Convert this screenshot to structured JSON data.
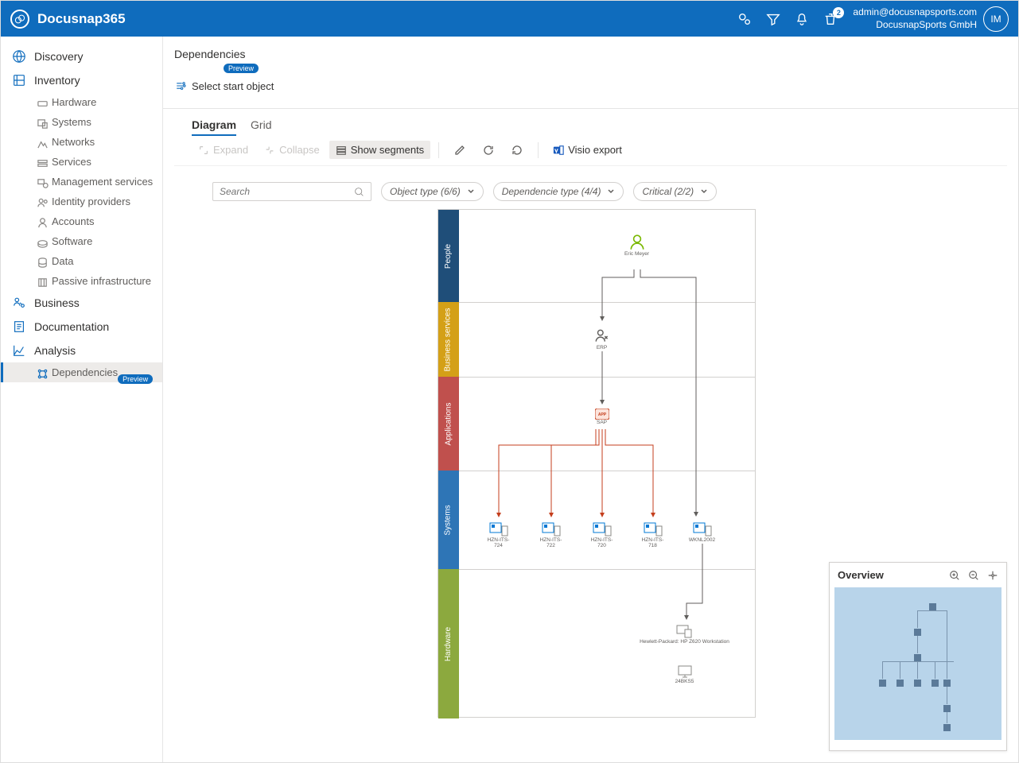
{
  "app": {
    "title": "Docusnap365"
  },
  "header": {
    "user_email": "admin@docusnapsports.com",
    "tenant": "DocusnapSports GmbH",
    "avatar_initials": "IM",
    "notification_count": "2"
  },
  "sidebar": {
    "discovery": "Discovery",
    "inventory": "Inventory",
    "inv_hardware": "Hardware",
    "inv_systems": "Systems",
    "inv_networks": "Networks",
    "inv_services": "Services",
    "inv_mgmt": "Management services",
    "inv_idp": "Identity providers",
    "inv_accounts": "Accounts",
    "inv_software": "Software",
    "inv_data": "Data",
    "inv_passive": "Passive infrastructure",
    "business": "Business",
    "documentation": "Documentation",
    "analysis": "Analysis",
    "dependencies": "Dependencies",
    "preview_badge": "Preview"
  },
  "main": {
    "title": "Dependencies",
    "preview_badge": "Preview",
    "select_start": "Select start object",
    "tab_diagram": "Diagram",
    "tab_grid": "Grid",
    "expand": "Expand",
    "collapse": "Collapse",
    "segments": "Show segments",
    "visio": "Visio export",
    "search_placeholder": "Search",
    "filter_objtype": "Object type (6/6)",
    "filter_deptype": "Dependencie type (4/4)",
    "filter_critical": "Critical (2/2)"
  },
  "segments": {
    "people": "People",
    "business_services": "Business services",
    "applications": "Applications",
    "systems": "Systems",
    "hardware": "Hardware"
  },
  "nodes": {
    "person": "Eric Meyer",
    "bs": "ERP",
    "app": "SAP",
    "sys1": "HZN-ITS-724",
    "sys2": "HZN-ITS-722",
    "sys3": "HZN-ITS-720",
    "sys4": "HZN-ITS-718",
    "sys5": "WKNL2002",
    "hw1": "Hewlett-Packard: HP Z620 Workstation",
    "hw2": "24BKS5"
  },
  "overview": {
    "title": "Overview"
  }
}
